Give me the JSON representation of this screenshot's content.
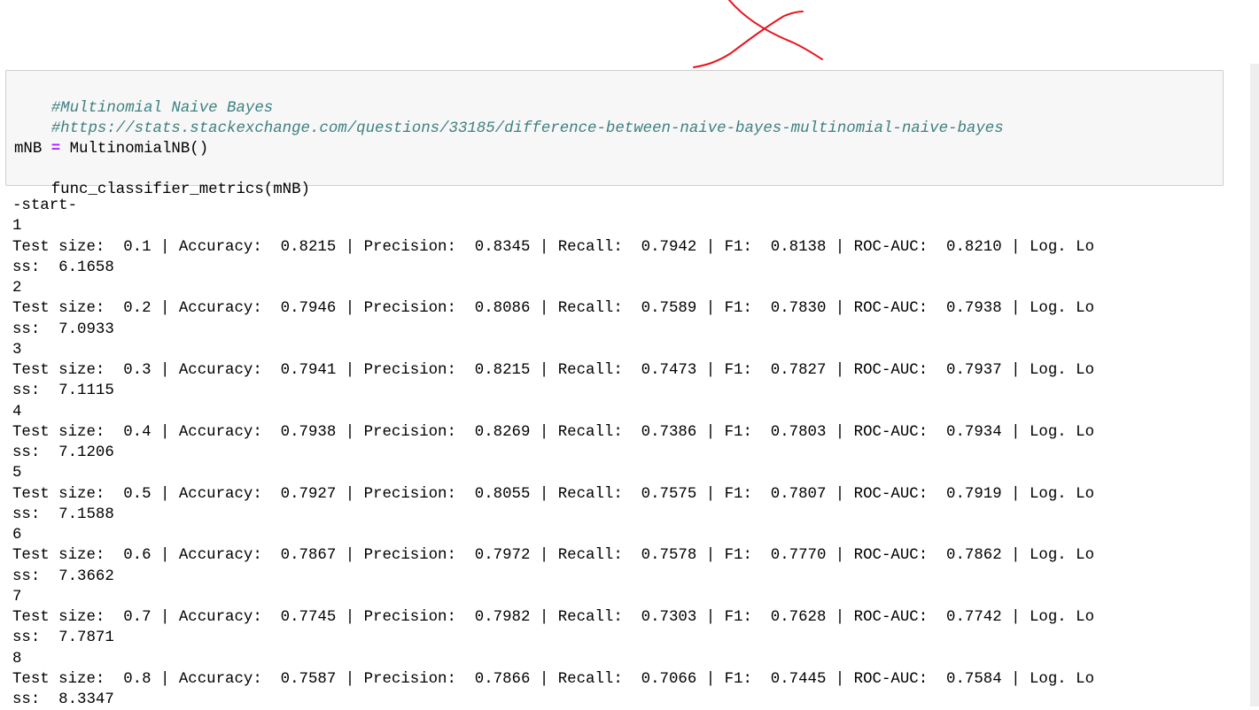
{
  "code_cell": {
    "comment_title": "#Multinomial Naive Bayes",
    "comment_url": "#https://stats.stackexchange.com/questions/33185/difference-between-naive-bayes-multinomial-naive-bayes",
    "assign_var": "mNB",
    "assign_op": "=",
    "assign_call": "MultinomialNB()",
    "call_line": "func_classifier_metrics(mNB)"
  },
  "output": {
    "lines": [
      "-start-",
      "1",
      "Test size:  0.1 | Accuracy:  0.8215 | Precision:  0.8345 | Recall:  0.7942 | F1:  0.8138 | ROC-AUC:  0.8210 | Log. Lo",
      "ss:  6.1658",
      "2",
      "Test size:  0.2 | Accuracy:  0.7946 | Precision:  0.8086 | Recall:  0.7589 | F1:  0.7830 | ROC-AUC:  0.7938 | Log. Lo",
      "ss:  7.0933",
      "3",
      "Test size:  0.3 | Accuracy:  0.7941 | Precision:  0.8215 | Recall:  0.7473 | F1:  0.7827 | ROC-AUC:  0.7937 | Log. Lo",
      "ss:  7.1115",
      "4",
      "Test size:  0.4 | Accuracy:  0.7938 | Precision:  0.8269 | Recall:  0.7386 | F1:  0.7803 | ROC-AUC:  0.7934 | Log. Lo",
      "ss:  7.1206",
      "5",
      "Test size:  0.5 | Accuracy:  0.7927 | Precision:  0.8055 | Recall:  0.7575 | F1:  0.7807 | ROC-AUC:  0.7919 | Log. Lo",
      "ss:  7.1588",
      "6",
      "Test size:  0.6 | Accuracy:  0.7867 | Precision:  0.7972 | Recall:  0.7578 | F1:  0.7770 | ROC-AUC:  0.7862 | Log. Lo",
      "ss:  7.3662",
      "7",
      "Test size:  0.7 | Accuracy:  0.7745 | Precision:  0.7982 | Recall:  0.7303 | F1:  0.7628 | ROC-AUC:  0.7742 | Log. Lo",
      "ss:  7.7871",
      "8",
      "Test size:  0.8 | Accuracy:  0.7587 | Precision:  0.7866 | Recall:  0.7066 | F1:  0.7445 | ROC-AUC:  0.7584 | Log. Lo",
      "ss:  8.3347"
    ]
  },
  "colors": {
    "comment": "#408080",
    "operator": "#aa22ff",
    "cell_background": "#f7f7f7",
    "cell_border": "#cfcfcf",
    "annotation_mark": "#e8141c"
  }
}
